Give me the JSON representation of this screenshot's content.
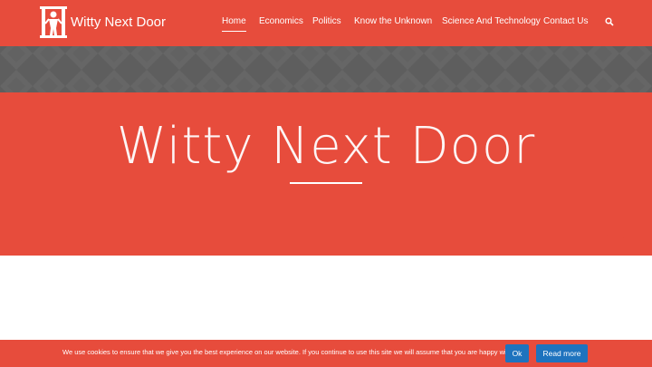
{
  "site": {
    "title": "Witty Next Door",
    "logo_icon": "person-logo-icon"
  },
  "nav": {
    "items": [
      {
        "label": "Home",
        "active": true
      },
      {
        "label": "Economics",
        "active": false
      },
      {
        "label": "Politics",
        "active": false
      },
      {
        "label": "Know the Unknown",
        "active": false
      },
      {
        "label": "Science And Technology",
        "active": false
      },
      {
        "label": "Contact Us",
        "active": false
      }
    ],
    "search_icon": "search-icon"
  },
  "hero": {
    "title": "Witty Next Door"
  },
  "cookie": {
    "message": "We use cookies to ensure that we give you the best experience on our website. If you continue to use this site we will assume that you are happy with it.",
    "ok_label": "Ok",
    "more_label": "Read more"
  },
  "colors": {
    "brand": "#e74c3c",
    "pattern": "#606060",
    "button": "#1e73be"
  }
}
